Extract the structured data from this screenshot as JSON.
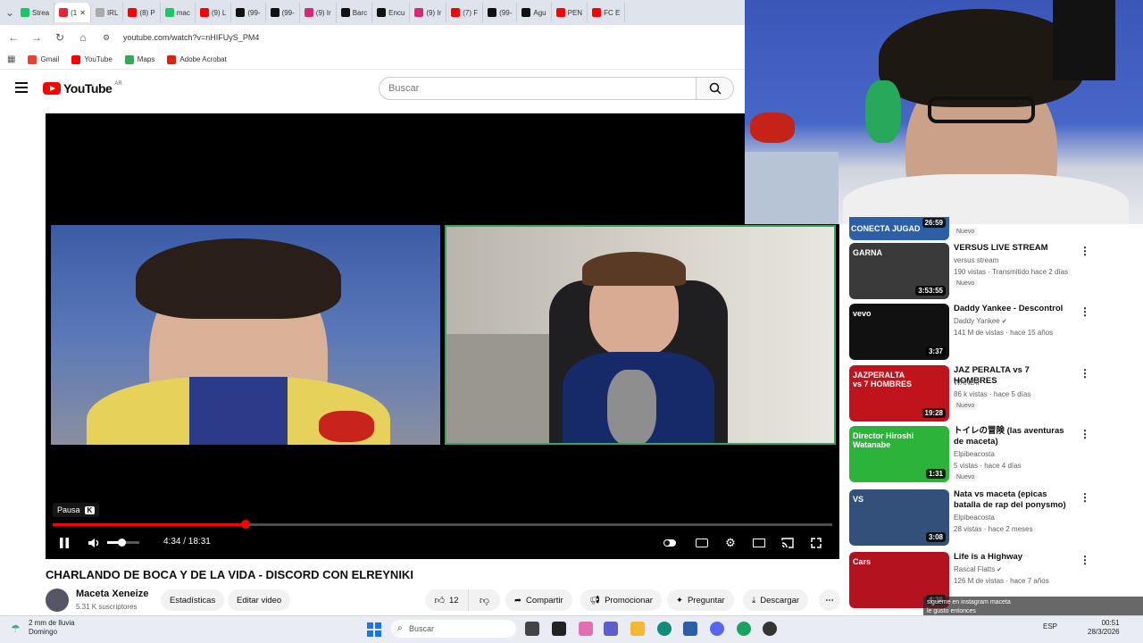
{
  "browser": {
    "tabs": [
      {
        "label": "Strea",
        "color": "#17c964"
      },
      {
        "label": "(1",
        "color": "#e23",
        "active": true
      },
      {
        "label": "IRL",
        "color": "#aaa"
      },
      {
        "label": "(8) P",
        "color": "#f00"
      },
      {
        "label": "mac",
        "color": "#17c964"
      },
      {
        "label": "(9) L",
        "color": "#f00"
      },
      {
        "label": "(99-",
        "color": "#111"
      },
      {
        "label": "(99-",
        "color": "#111"
      },
      {
        "label": "(9) Ir",
        "color": "#d62976"
      },
      {
        "label": "Barc",
        "color": "#111"
      },
      {
        "label": "Encu",
        "color": "#111"
      },
      {
        "label": "(9) Ir",
        "color": "#d62976"
      },
      {
        "label": "(7) F",
        "color": "#f00"
      },
      {
        "label": "(99-",
        "color": "#111"
      },
      {
        "label": "Agu",
        "color": "#111"
      },
      {
        "label": "PEN",
        "color": "#f00"
      },
      {
        "label": "FC E",
        "color": "#f00"
      }
    ],
    "url": "youtube.com/watch?v=nHIFUyS_PM4",
    "bookmarks": [
      {
        "label": "Gmail",
        "icon": "gmail-icon",
        "color": "#ea4335"
      },
      {
        "label": "YouTube",
        "icon": "youtube-icon",
        "color": "#f00"
      },
      {
        "label": "Maps",
        "icon": "maps-icon",
        "color": "#34a853"
      },
      {
        "label": "Adobe Acrobat",
        "icon": "acrobat-icon",
        "color": "#d21"
      }
    ]
  },
  "youtube": {
    "logo": "YouTube",
    "region": "AR",
    "search_placeholder": "Buscar"
  },
  "player": {
    "tooltip": "Pausa",
    "tooltip_key": "K",
    "time": "4:34 / 18:31",
    "progress": 0.247,
    "volume": 0.45
  },
  "video": {
    "title": "CHARLANDO DE BOCA Y DE LA VIDA - DISCORD CON ELREYNIKI",
    "channel": "Maceta Xeneize",
    "subscribers": "5.31 K suscriptores",
    "actions": {
      "stats": "Estadísticas",
      "edit": "Editar video",
      "likes": "12",
      "share": "Compartir",
      "promote": "Promocionar",
      "ask": "Preguntar",
      "download": "Descargar"
    }
  },
  "recommendations": [
    {
      "partial": true,
      "thumb_text": "CONECTA JUGAD",
      "duration": "26:59",
      "badge": "Nuevo"
    },
    {
      "title": "VERSUS LIVE STREAM",
      "channel": "versus stream",
      "meta": "190 vistas · Transmitido hace 2 días",
      "duration": "3:53:55",
      "badge": "Nuevo",
      "thumb_text": "GARNA",
      "thumb_color": "#3a3a3a"
    },
    {
      "title": "Daddy Yankee - Descontrol",
      "channel": "Daddy Yankee",
      "verified": true,
      "meta": "141 M de vistas · hace 15 años",
      "duration": "3:37",
      "thumb_text": "vevo",
      "thumb_color": "#111"
    },
    {
      "title": "JAZ PERALTA vs 7 HOMBRES",
      "channel": "WANDII",
      "meta": "86 k vistas · hace 5 días",
      "duration": "19:28",
      "badge": "Nuevo",
      "thumb_text": "JAZPERALTA vs 7 HOMBRES",
      "thumb_color": "#c0141c"
    },
    {
      "title": "トイレの冒険 (las aventuras de maceta)",
      "channel": "Elpibeacosta",
      "meta": "5 vistas · hace 4 días",
      "duration": "1:31",
      "badge": "Nuevo",
      "thumb_text": "Director Hiroshi Watanabe",
      "thumb_color": "#2bb33a"
    },
    {
      "title": "Nata vs maceta (epicas batalla de rap del ponysmo)",
      "channel": "Elpibeacosta",
      "meta": "28 vistas · hace 2 meses",
      "duration": "3:08",
      "thumb_text": "VS",
      "thumb_color": "#33507a"
    },
    {
      "title": "Life is a Highway",
      "channel": "Rascal Flatts",
      "verified": true,
      "meta": "126 M de vistas · hace 7 años",
      "duration": "4:36",
      "thumb_text": "Cars",
      "thumb_color": "#b3121e"
    }
  ],
  "chat_overlay": [
    "sigueme en instagram maceta",
    "le gusto entonces",
    "le gusto entonces"
  ],
  "taskbar": {
    "weather": "2 mm de lluvia",
    "day": "Domingo",
    "search": "Buscar",
    "time": "00:51",
    "date": "28/3/2026",
    "lang": "ESP"
  }
}
